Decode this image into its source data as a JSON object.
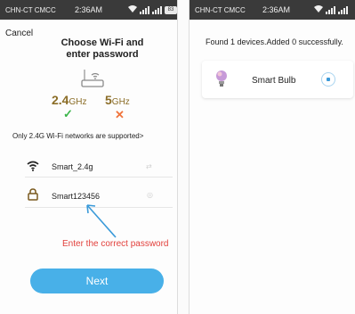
{
  "status_bar": {
    "carrier": "CHN-CT CMCC",
    "time": "2:36AM",
    "battery": "83"
  },
  "wifi_setup": {
    "cancel_label": "Cancel",
    "title_line1": "Choose Wi-Fi and",
    "title_line2": "enter password",
    "band_24_value": "2.4",
    "band_24_unit": "GHz",
    "band_5_value": "5",
    "band_5_unit": "GHz",
    "band_24_mark": "✓",
    "band_5_mark": "✕",
    "support_note": "Only 2.4G Wi-Fi networks are supported>",
    "ssid_value": "Smart_2.4g",
    "password_value": "Smart123456",
    "hint_text": "Enter the correct password",
    "next_label": "Next"
  },
  "device_result": {
    "found_text": "Found 1 devices.Added 0 successfully.",
    "device_name": "Smart Bulb"
  },
  "colors": {
    "accent_blue": "#48b0e8",
    "hint_red": "#e2403c",
    "check_green": "#3bb54a",
    "cross_orange": "#f0743c",
    "band_gold": "#8b6d27"
  },
  "icons": [
    "wifi-icon",
    "lock-icon",
    "router-icon",
    "bulb-icon",
    "arrow-icon"
  ]
}
